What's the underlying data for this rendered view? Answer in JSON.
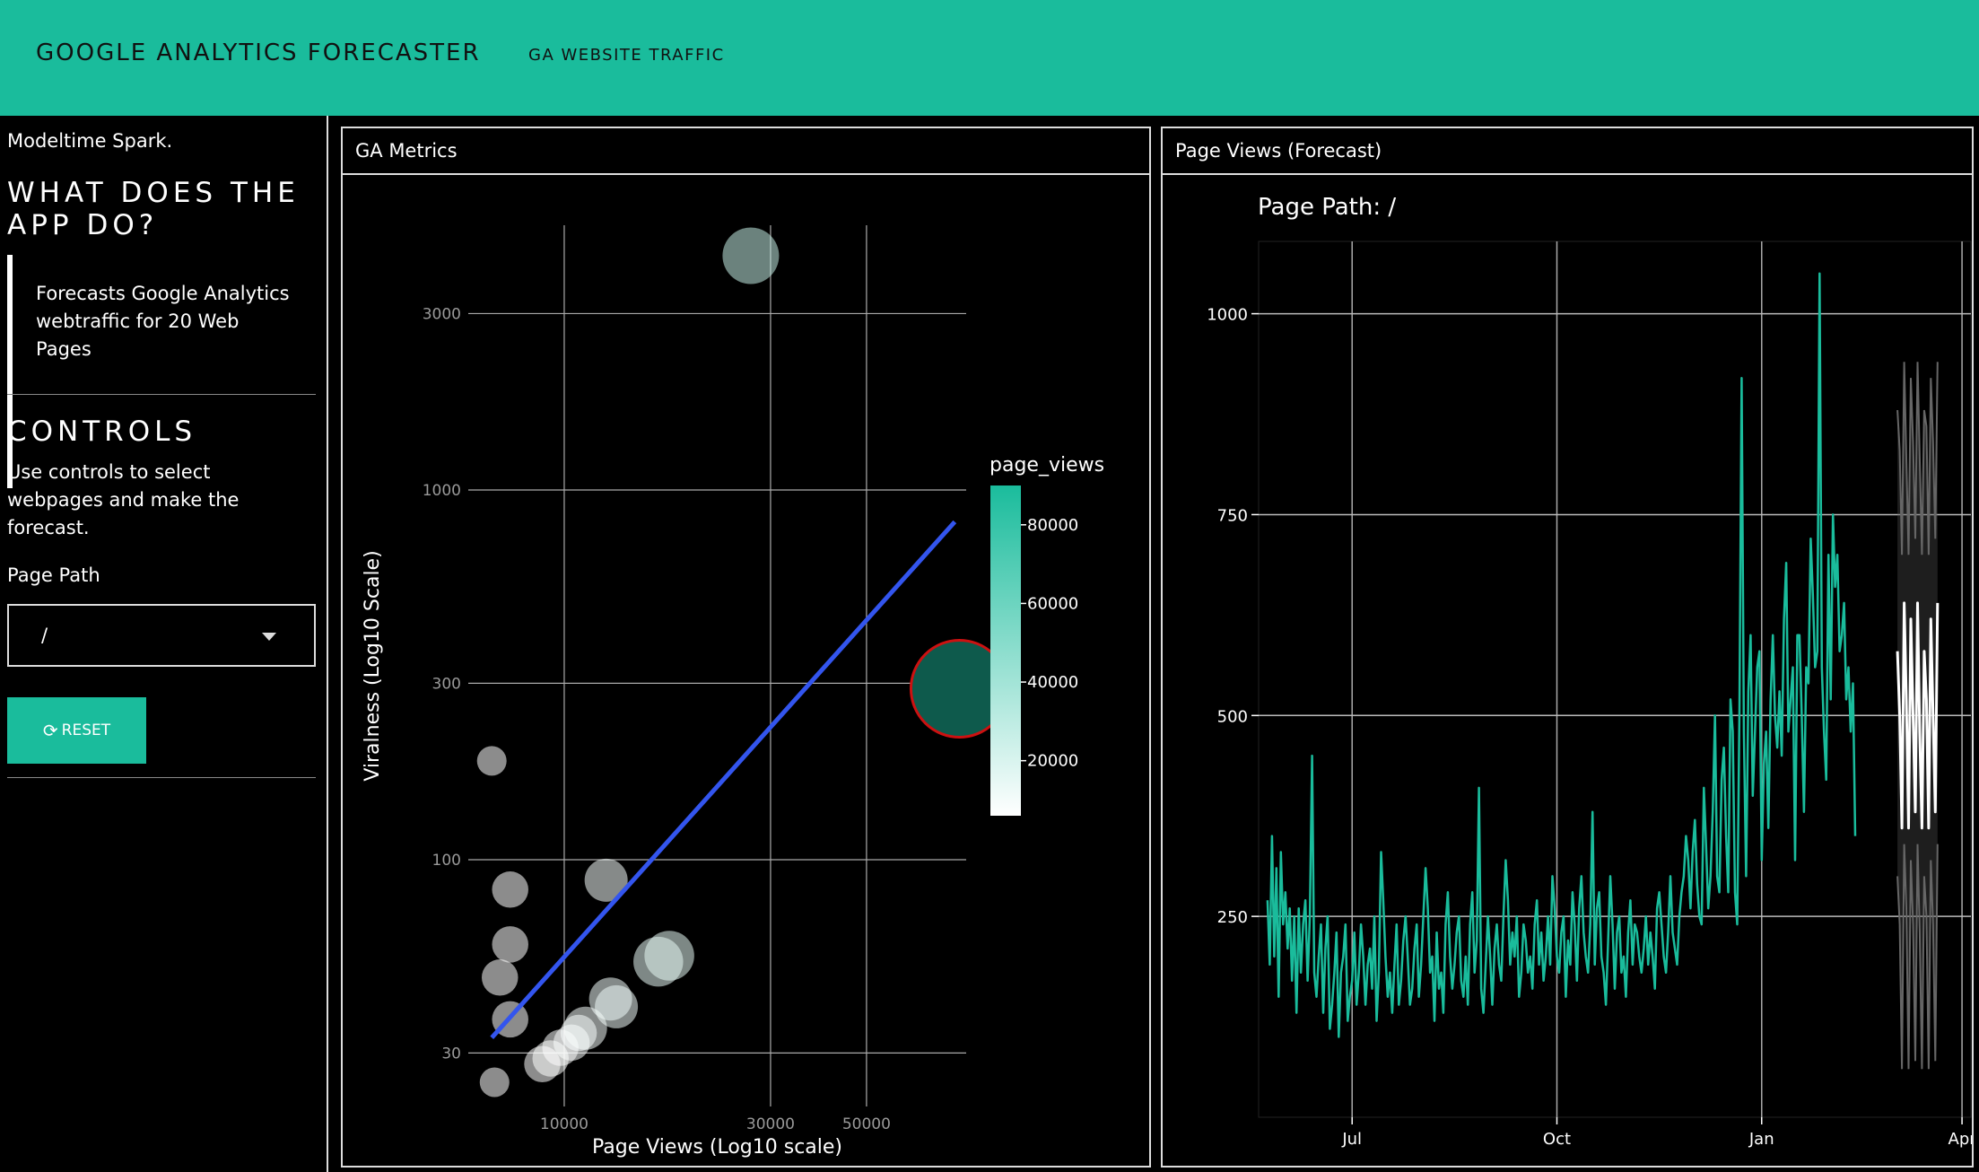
{
  "navbar": {
    "brand": "GOOGLE ANALYTICS FORECASTER",
    "link": "GA WEBSITE TRAFFIC"
  },
  "sidebar": {
    "subtitle": "Modeltime Spark.",
    "heading": "WHAT DOES THE APP DO?",
    "description": "Forecasts Google Analytics webtraffic for 20 Web Pages",
    "controls_heading": "CONTROLS",
    "controls_help": "Use controls to select webpages and make the forecast.",
    "page_path_label": "Page Path",
    "page_path_value": "/",
    "reset_label": "RESET",
    "reset_icon": "refresh-icon"
  },
  "colors": {
    "accent": "#1abc9c",
    "trend": "#3355ee",
    "highlight_outline": "#cc1111",
    "forecast": "#ffffff"
  },
  "metrics_card": {
    "title": "GA Metrics"
  },
  "forecast_card": {
    "title": "Page Views (Forecast)"
  },
  "chart_data": [
    {
      "type": "scatter",
      "title": "",
      "xlabel": "Page Views (Log10 scale)",
      "ylabel": "Viralness (Log10 Scale)",
      "x_scale": "log10",
      "y_scale": "log10",
      "x_ticks": [
        10000,
        30000,
        50000
      ],
      "y_ticks": [
        30,
        100,
        300,
        1000,
        3000
      ],
      "grid": true,
      "legend": {
        "title": "page_views",
        "type": "colorbar",
        "ticks": [
          20000,
          40000,
          60000,
          80000
        ],
        "placement": "right"
      },
      "trend_line": {
        "from": [
          6800,
          33
        ],
        "to": [
          80000,
          820
        ]
      },
      "points": [
        {
          "x": 27000,
          "y": 4300,
          "page_views": 30000,
          "size": 3
        },
        {
          "x": 82000,
          "y": 290,
          "page_views": 83000,
          "size": 6,
          "highlighted": true
        },
        {
          "x": 6800,
          "y": 185,
          "page_views": 4000,
          "size": 1
        },
        {
          "x": 12500,
          "y": 88,
          "page_views": 12000,
          "size": 2
        },
        {
          "x": 7500,
          "y": 83,
          "page_views": 5000,
          "size": 1.5
        },
        {
          "x": 7500,
          "y": 59,
          "page_views": 5500,
          "size": 1.5
        },
        {
          "x": 7100,
          "y": 48,
          "page_views": 4500,
          "size": 1.5
        },
        {
          "x": 7500,
          "y": 37,
          "page_views": 6000,
          "size": 1.5
        },
        {
          "x": 6900,
          "y": 25,
          "page_views": 3000,
          "size": 1
        },
        {
          "x": 16500,
          "y": 53,
          "page_views": 17000,
          "size": 2.5
        },
        {
          "x": 17500,
          "y": 55,
          "page_views": 18000,
          "size": 2.5
        },
        {
          "x": 12800,
          "y": 42,
          "page_views": 13000,
          "size": 2
        },
        {
          "x": 13200,
          "y": 40,
          "page_views": 14000,
          "size": 2
        },
        {
          "x": 11200,
          "y": 35,
          "page_views": 12000,
          "size": 2
        },
        {
          "x": 10800,
          "y": 34,
          "page_views": 11000,
          "size": 1.5
        },
        {
          "x": 10400,
          "y": 32,
          "page_views": 10000,
          "size": 1.5
        },
        {
          "x": 9800,
          "y": 31,
          "page_views": 9000,
          "size": 1.5
        },
        {
          "x": 9300,
          "y": 29,
          "page_views": 8500,
          "size": 1.5
        },
        {
          "x": 8900,
          "y": 28,
          "page_views": 8000,
          "size": 1.5
        }
      ]
    },
    {
      "type": "line",
      "title": "Page Path: /",
      "x_ticks": [
        "Jul",
        "Oct",
        "Jan",
        "Apr"
      ],
      "x_range": [
        "2020-05-20",
        "2021-04-05"
      ],
      "y_ticks": [
        250,
        500,
        750,
        1000
      ],
      "ylim": [
        0,
        1090
      ],
      "grid": true,
      "series": [
        {
          "kind": "actual",
          "start": "2020-05-24",
          "values": [
            270,
            190,
            350,
            200,
            310,
            150,
            330,
            240,
            280,
            210,
            260,
            170,
            250,
            130,
            260,
            180,
            240,
            270,
            170,
            250,
            450,
            180,
            150,
            200,
            240,
            130,
            210,
            250,
            110,
            140,
            180,
            230,
            100,
            180,
            200,
            240,
            120,
            150,
            170,
            230,
            140,
            180,
            240,
            200,
            140,
            190,
            210,
            160,
            250,
            120,
            180,
            330,
            270,
            200,
            150,
            180,
            130,
            190,
            240,
            140,
            170,
            220,
            250,
            200,
            140,
            160,
            210,
            240,
            150,
            190,
            250,
            310,
            260,
            180,
            200,
            120,
            230,
            160,
            180,
            130,
            240,
            280,
            200,
            160,
            190,
            230,
            250,
            170,
            150,
            200,
            140,
            240,
            280,
            180,
            220,
            410,
            160,
            130,
            190,
            250,
            200,
            140,
            210,
            240,
            190,
            170,
            250,
            320,
            270,
            190,
            230,
            200,
            250,
            150,
            180,
            240,
            220,
            180,
            200,
            160,
            240,
            270,
            190,
            230,
            170,
            200,
            250,
            190,
            300,
            260,
            200,
            180,
            230,
            250,
            150,
            220,
            190,
            280,
            240,
            170,
            260,
            300,
            230,
            200,
            180,
            240,
            380,
            190,
            260,
            280,
            200,
            180,
            140,
            220,
            300,
            240,
            160,
            230,
            250,
            180,
            200,
            150,
            230,
            270,
            190,
            240,
            230,
            200,
            180,
            210,
            250,
            190,
            230,
            200,
            160,
            260,
            280,
            240,
            200,
            180,
            230,
            300,
            230,
            210,
            190,
            250,
            280,
            300,
            350,
            320,
            260,
            330,
            370,
            290,
            250,
            240,
            410,
            340,
            260,
            300,
            380,
            500,
            300,
            280,
            420,
            460,
            350,
            280,
            520,
            480,
            280,
            240,
            510,
            920,
            480,
            300,
            530,
            600,
            400,
            480,
            560,
            580,
            320,
            440,
            480,
            360,
            520,
            600,
            500,
            460,
            530,
            450,
            620,
            690,
            480,
            520,
            560,
            320,
            600,
            600,
            500,
            380,
            560,
            540,
            720,
            650,
            560,
            580,
            1050,
            560,
            480,
            420,
            700,
            520,
            750,
            660,
            700,
            580,
            600,
            640,
            520,
            560,
            480,
            540,
            350
          ]
        },
        {
          "kind": "forecast",
          "start": "2021-03-03",
          "values": [
            580,
            500,
            360,
            640,
            520,
            360,
            620,
            500,
            380,
            640,
            480,
            360,
            580,
            520,
            360,
            620,
            500,
            380,
            640
          ]
        },
        {
          "kind": "conf_upper",
          "start": "2021-03-03",
          "values": [
            880,
            830,
            700,
            940,
            820,
            700,
            920,
            840,
            720,
            940,
            820,
            700,
            880,
            860,
            700,
            920,
            840,
            720,
            940
          ]
        },
        {
          "kind": "conf_lower",
          "start": "2021-03-03",
          "values": [
            300,
            240,
            60,
            340,
            260,
            60,
            320,
            240,
            70,
            340,
            230,
            60,
            300,
            250,
            60,
            320,
            240,
            70,
            340
          ]
        }
      ]
    }
  ]
}
